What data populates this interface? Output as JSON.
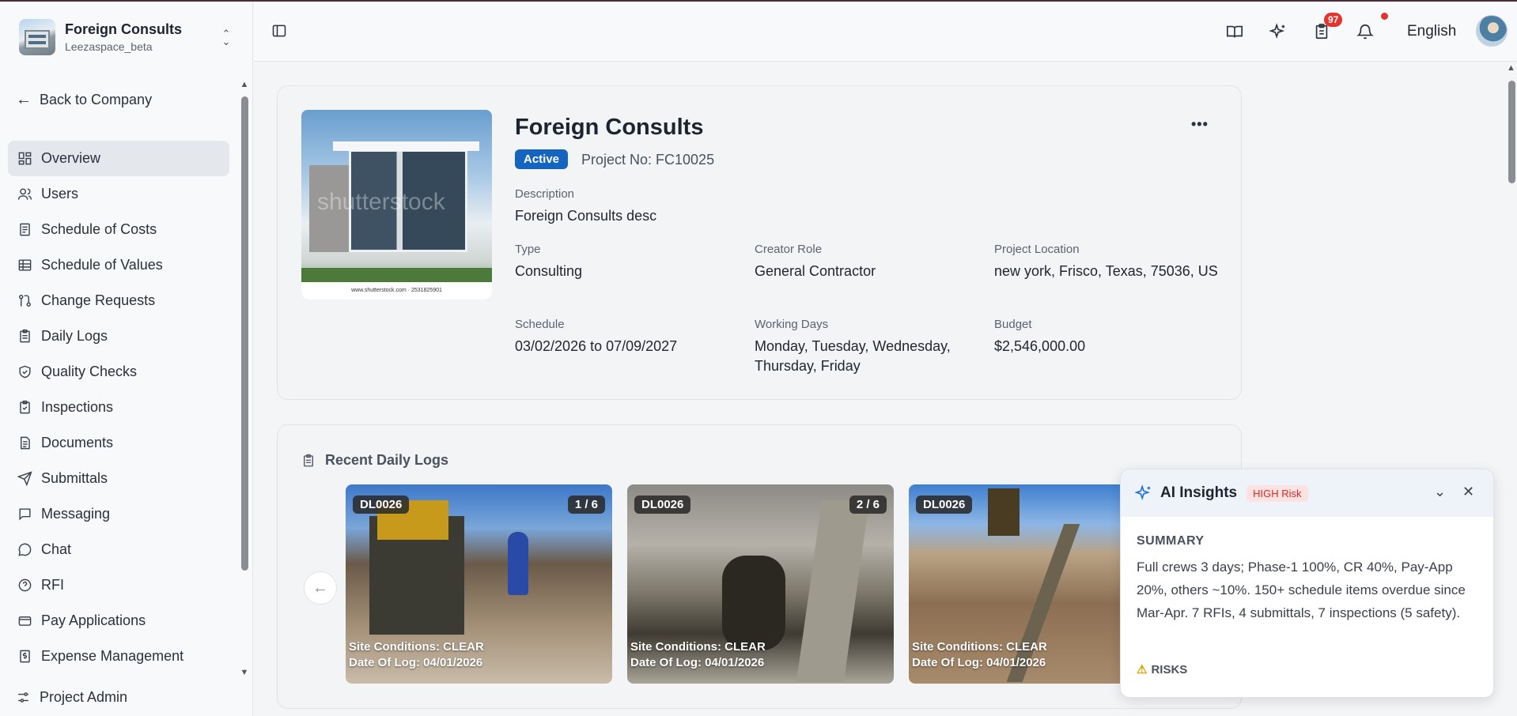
{
  "company": {
    "name": "Foreign Consults",
    "workspace": "Leezaspace_beta"
  },
  "sidebar": {
    "back_label": "Back to Company",
    "items": [
      {
        "label": "Overview",
        "icon": "overview-icon"
      },
      {
        "label": "Users",
        "icon": "users-icon"
      },
      {
        "label": "Schedule of Costs",
        "icon": "document-icon"
      },
      {
        "label": "Schedule of Values",
        "icon": "table-icon"
      },
      {
        "label": "Change Requests",
        "icon": "git-compare-icon"
      },
      {
        "label": "Daily Logs",
        "icon": "clipboard-icon"
      },
      {
        "label": "Quality Checks",
        "icon": "shield-check-icon"
      },
      {
        "label": "Inspections",
        "icon": "clipboard-check-icon"
      },
      {
        "label": "Documents",
        "icon": "file-text-icon"
      },
      {
        "label": "Submittals",
        "icon": "send-icon"
      },
      {
        "label": "Messaging",
        "icon": "message-square-icon"
      },
      {
        "label": "Chat",
        "icon": "message-circle-icon"
      },
      {
        "label": "RFI",
        "icon": "help-circle-icon"
      },
      {
        "label": "Pay Applications",
        "icon": "wallet-icon"
      },
      {
        "label": "Expense Management",
        "icon": "dollar-receipt-icon"
      }
    ],
    "admin_label": "Project Admin"
  },
  "header": {
    "tasks_count": "97",
    "language": "English"
  },
  "project": {
    "title": "Foreign Consults",
    "status": "Active",
    "project_no": "Project No: FC10025",
    "image_watermark": "shutterstock",
    "image_footer": "www.shutterstock.com · 2531825901",
    "fields": {
      "description": {
        "label": "Description",
        "value": "Foreign Consults desc"
      },
      "type": {
        "label": "Type",
        "value": "Consulting"
      },
      "creator_role": {
        "label": "Creator Role",
        "value": "General Contractor"
      },
      "location": {
        "label": "Project Location",
        "value": "new york, Frisco, Texas, 75036, US"
      },
      "schedule": {
        "label": "Schedule",
        "value": "03/02/2026 to 07/09/2027"
      },
      "working_days": {
        "label": "Working Days",
        "value": "Monday, Tuesday, Wednesday, Thursday, Friday"
      },
      "budget": {
        "label": "Budget",
        "value": "$2,546,000.00"
      }
    }
  },
  "daily_logs": {
    "title": "Recent Daily Logs",
    "photos": [
      {
        "id": "DL0026",
        "index": "1 / 6",
        "conditions": "Site Conditions: CLEAR",
        "date": "Date Of Log: 04/01/2026"
      },
      {
        "id": "DL0026",
        "index": "2 / 6",
        "conditions": "Site Conditions: CLEAR",
        "date": "Date Of Log: 04/01/2026"
      },
      {
        "id": "DL0026",
        "index": "",
        "conditions": "Site Conditions: CLEAR",
        "date": "Date Of Log: 04/01/2026"
      }
    ]
  },
  "ai_insights": {
    "title": "AI Insights",
    "risk_badge": "HIGH Risk",
    "summary_label": "SUMMARY",
    "summary": "Full crews 3 days; Phase-1 100%, CR 40%, Pay-App 20%, others ~10%. 150+ schedule items overdue since Mar-Apr. 7 RFIs, 4 submittals, 7 inspections (5 safety).",
    "risks_label": "RISKS"
  },
  "colors": {
    "accent": "#1565c0",
    "danger": "#e3342f",
    "ai_accent": "#1e6fd9"
  }
}
